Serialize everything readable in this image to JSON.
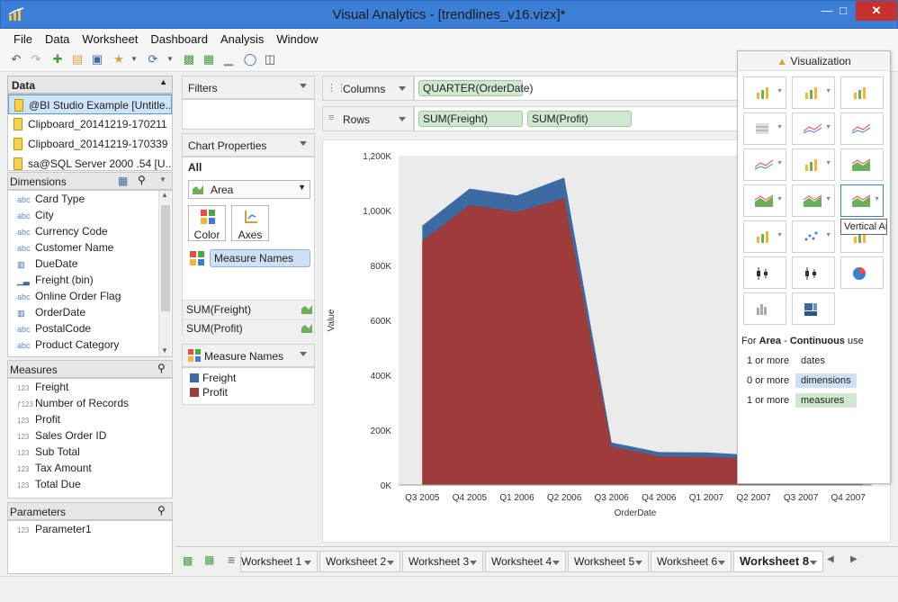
{
  "window": {
    "title": "Visual Analytics - [trendlines_v16.vizx]*"
  },
  "menu": [
    "File",
    "Data",
    "Worksheet",
    "Dashboard",
    "Analysis",
    "Window"
  ],
  "data_panel": {
    "header": "Data",
    "sources": [
      "@BI Studio Example [Untitle...",
      "Clipboard_20141219-170211",
      "Clipboard_20141219-170339",
      "sa@SQL Server 2000 .54 [U..."
    ]
  },
  "dimensions": {
    "header": "Dimensions",
    "items": [
      {
        "type": "abc",
        "label": "Card Type"
      },
      {
        "type": "abc",
        "label": "City"
      },
      {
        "type": "abc",
        "label": "Currency Code"
      },
      {
        "type": "abc",
        "label": "Customer Name"
      },
      {
        "type": "date",
        "label": "DueDate"
      },
      {
        "type": "bin",
        "label": "Freight (bin)"
      },
      {
        "type": "abc",
        "label": "Online Order Flag"
      },
      {
        "type": "date",
        "label": "OrderDate"
      },
      {
        "type": "abc",
        "label": "PostalCode"
      },
      {
        "type": "abc",
        "label": "Product Category"
      }
    ]
  },
  "measures": {
    "header": "Measures",
    "items": [
      {
        "type": "123",
        "label": "Freight"
      },
      {
        "type": "f123",
        "label": "Number of Records"
      },
      {
        "type": "123",
        "label": "Profit"
      },
      {
        "type": "123",
        "label": "Sales Order ID"
      },
      {
        "type": "123",
        "label": "Sub Total"
      },
      {
        "type": "123",
        "label": "Tax Amount"
      },
      {
        "type": "123",
        "label": "Total Due"
      }
    ]
  },
  "parameters": {
    "header": "Parameters",
    "items": [
      {
        "type": "123",
        "label": "Parameter1"
      }
    ]
  },
  "filters": {
    "header": "Filters"
  },
  "chart_properties": {
    "header": "Chart Properties",
    "scope": "All",
    "mark_type": "Area",
    "color_label": "Color",
    "axes_label": "Axes",
    "color_field": "Measure Names",
    "measures": [
      "SUM(Freight)",
      "SUM(Profit)"
    ]
  },
  "legend": {
    "header": "Measure Names",
    "entries": [
      {
        "label": "Freight",
        "color": "#3c6aa3"
      },
      {
        "label": "Profit",
        "color": "#9e3b3b"
      }
    ]
  },
  "shelves": {
    "columns_label": "Columns",
    "rows_label": "Rows",
    "columns_pills": [
      "QUARTER(OrderDate)"
    ],
    "rows_pills": [
      "SUM(Freight)",
      "SUM(Profit)"
    ]
  },
  "chart_data": {
    "type": "area",
    "categories": [
      "Q3 2005",
      "Q4 2005",
      "Q1 2006",
      "Q2 2006",
      "Q3 2006",
      "Q4 2006",
      "Q1 2007",
      "Q2 2007",
      "Q3 2007",
      "Q4 2007"
    ],
    "series": [
      {
        "name": "Profit",
        "color": "#9e3b3b",
        "values": [
          890000,
          1020000,
          995000,
          1045000,
          140000,
          105000,
          103000,
          95000,
          0,
          0
        ]
      },
      {
        "name": "Freight",
        "color": "#3c6aa3",
        "values": [
          55000,
          60000,
          60000,
          75000,
          15000,
          15000,
          16000,
          14000,
          0,
          0
        ]
      }
    ],
    "stacked": true,
    "y_ticks": [
      "0K",
      "200K",
      "400K",
      "600K",
      "800K",
      "1,000K",
      "1,200K"
    ],
    "ylim": [
      0,
      1200000
    ],
    "xlabel": "OrderDate",
    "ylabel": "Value",
    "grid": false
  },
  "visualization_panel": {
    "header": "Visualization",
    "tooltip": "Vertical Are",
    "rule_prefix": "For",
    "rule_type": "Area",
    "rule_sep": "-",
    "rule_mode": "Continuous",
    "rule_suffix": "use",
    "requirements": [
      {
        "count": "1 or more",
        "what": "dates",
        "tag": "none"
      },
      {
        "count": "0 or more",
        "what": "dimensions",
        "tag": "blue"
      },
      {
        "count": "1 or more",
        "what": "measures",
        "tag": "green"
      }
    ]
  },
  "sheet_tabs": [
    "Worksheet 1",
    "Worksheet 2",
    "Worksheet 3",
    "Worksheet 4",
    "Worksheet 5",
    "Worksheet 6",
    "Worksheet 8"
  ],
  "active_tab": "Worksheet 8"
}
